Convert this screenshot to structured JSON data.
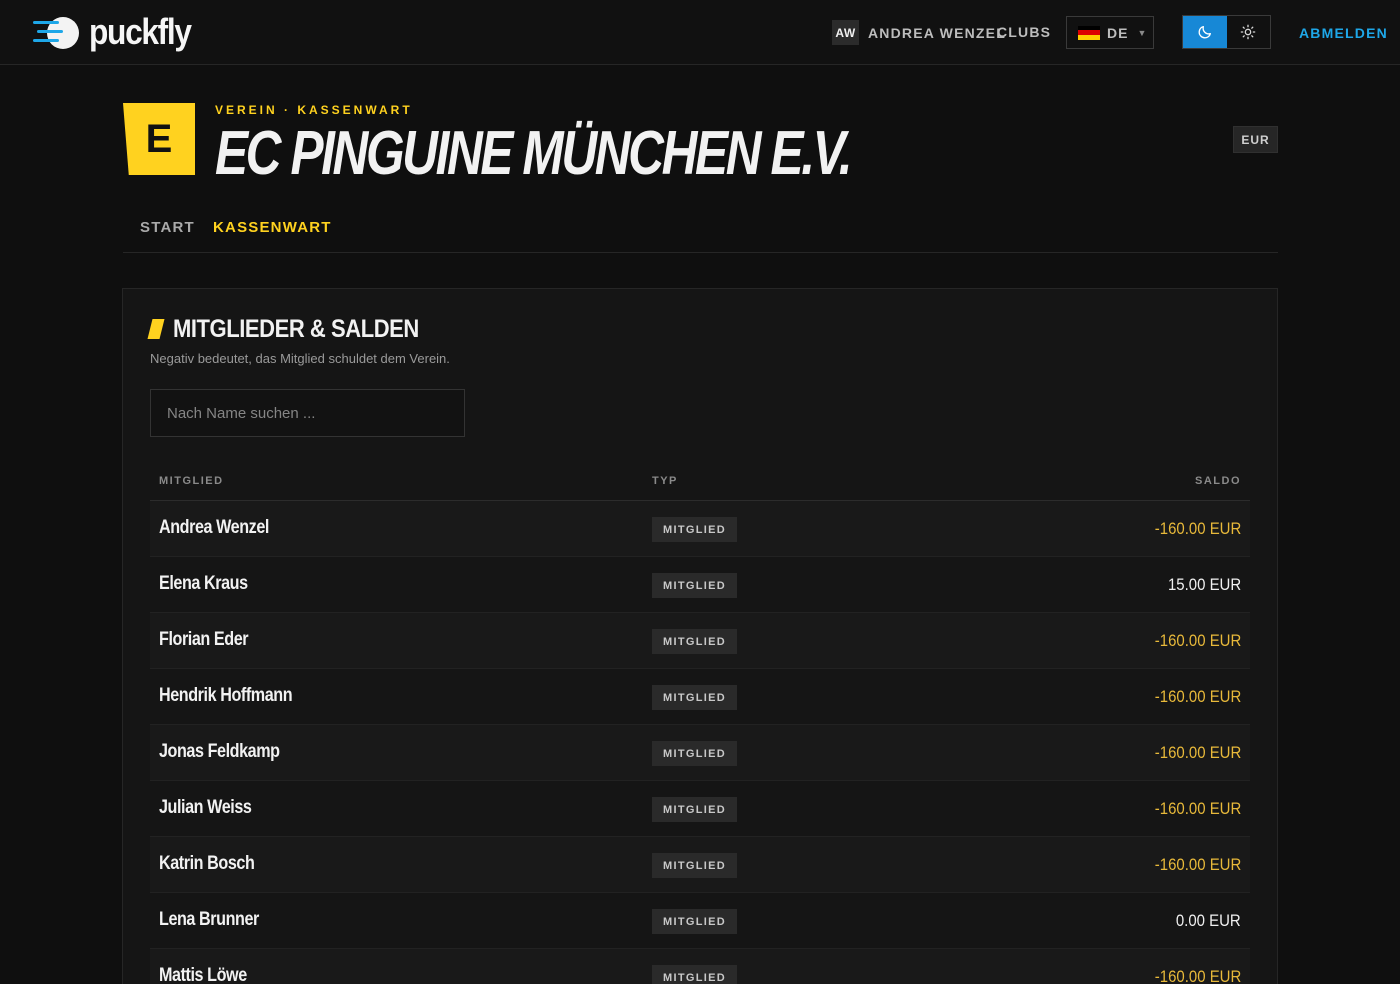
{
  "app": {
    "logo_text": "puckfly",
    "user_initials": "AW",
    "user_name": "ANDREA WENZEL",
    "clubs_label": "CLUBS",
    "language_code": "DE",
    "logout_label": "ABMELDEN"
  },
  "colors": {
    "accent_yellow": "#ffd21f",
    "accent_blue": "#1ea7e8",
    "theme_active_bg": "#1788d6",
    "negative_balance": "#e8b93a",
    "positive_balance": "#f0f0f0"
  },
  "icons": {
    "logo": "puck-logo-icon",
    "language_flag": "german-flag-icon",
    "chevron": "chevron-down-icon",
    "dark_theme": "moon-icon",
    "light_theme": "sun-icon"
  },
  "club": {
    "badge_letter": "E",
    "kicker": "VEREIN · KASSENWART",
    "name": "EC PINGUINE MÜNCHEN E.V.",
    "currency": "EUR"
  },
  "tabs": [
    {
      "label": "START",
      "active": false
    },
    {
      "label": "KASSENWART",
      "active": true
    }
  ],
  "members_card": {
    "title": "MITGLIEDER & SALDEN",
    "subtitle": "Negativ bedeutet, das Mitglied schuldet dem Verein.",
    "search_placeholder": "Nach Name suchen ...",
    "columns": {
      "member": "MITGLIED",
      "type": "TYP",
      "balance": "SALDO"
    },
    "rows": [
      {
        "name": "Andrea Wenzel",
        "type": "MITGLIED",
        "balance": "-160.00 EUR",
        "negative": true
      },
      {
        "name": "Elena Kraus",
        "type": "MITGLIED",
        "balance": "15.00 EUR",
        "negative": false
      },
      {
        "name": "Florian Eder",
        "type": "MITGLIED",
        "balance": "-160.00 EUR",
        "negative": true
      },
      {
        "name": "Hendrik Hoffmann",
        "type": "MITGLIED",
        "balance": "-160.00 EUR",
        "negative": true
      },
      {
        "name": "Jonas Feldkamp",
        "type": "MITGLIED",
        "balance": "-160.00 EUR",
        "negative": true
      },
      {
        "name": "Julian Weiss",
        "type": "MITGLIED",
        "balance": "-160.00 EUR",
        "negative": true
      },
      {
        "name": "Katrin Bosch",
        "type": "MITGLIED",
        "balance": "-160.00 EUR",
        "negative": true
      },
      {
        "name": "Lena Brunner",
        "type": "MITGLIED",
        "balance": "0.00 EUR",
        "negative": false
      },
      {
        "name": "Mattis Löwe",
        "type": "MITGLIED",
        "balance": "-160.00 EUR",
        "negative": true
      }
    ]
  }
}
